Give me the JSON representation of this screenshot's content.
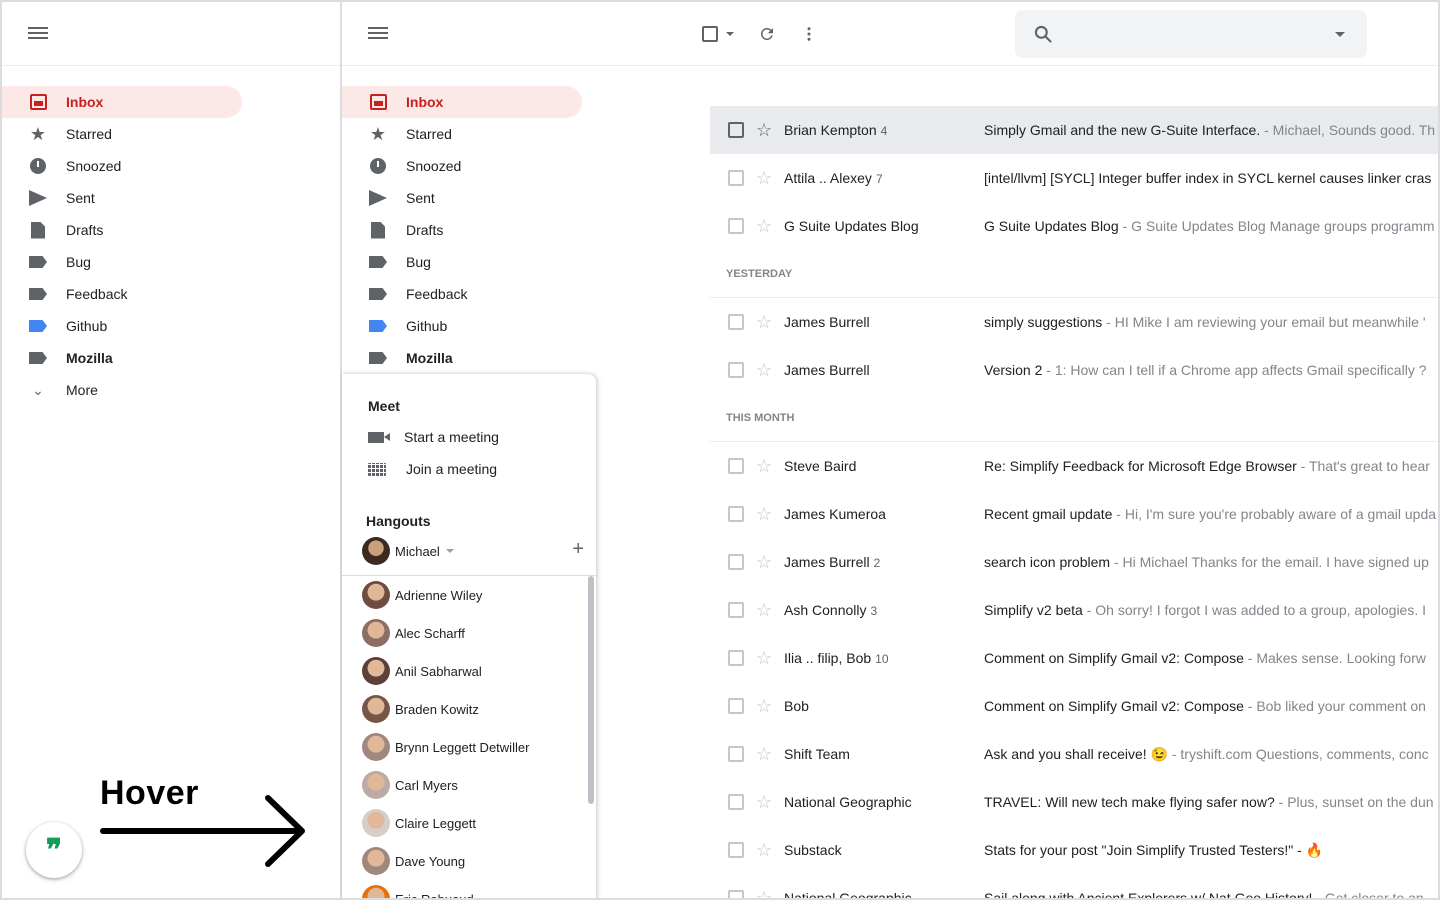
{
  "nav": [
    {
      "label": "Inbox",
      "icon": "inbox-icon",
      "active": true
    },
    {
      "label": "Starred",
      "icon": "star-icon"
    },
    {
      "label": "Snoozed",
      "icon": "clock-icon"
    },
    {
      "label": "Sent",
      "icon": "send-icon"
    },
    {
      "label": "Drafts",
      "icon": "draft-icon"
    },
    {
      "label": "Bug",
      "icon": "label-icon"
    },
    {
      "label": "Feedback",
      "icon": "label-icon"
    },
    {
      "label": "Github",
      "icon": "label-icon",
      "color": "#4285f4"
    },
    {
      "label": "Mozilla",
      "icon": "label-icon",
      "bold": true
    },
    {
      "label": "More",
      "icon": "chevron-down-icon"
    }
  ],
  "annotation": {
    "text": "Hover"
  },
  "hangouts_fab": {
    "glyph": "❞"
  },
  "popup": {
    "meet_title": "Meet",
    "start_meeting": "Start a meeting",
    "join_meeting": "Join a meeting",
    "hangouts_title": "Hangouts",
    "me_name": "Michael",
    "contacts": [
      "Adrienne Wiley",
      "Alec Scharff",
      "Anil Sabharwal",
      "Braden Kowitz",
      "Brynn Leggett Detwiller",
      "Carl Myers",
      "Claire Leggett",
      "Dave Young",
      "Eric Rabuaud"
    ]
  },
  "emails_top": [
    {
      "sender": "Brian Kempton",
      "count": "4",
      "subject": "Simply Gmail and the new G-Suite Interface.",
      "snippet": " - Michael, Sounds good. Th",
      "selected": true
    },
    {
      "sender": "Attila .. Alexey",
      "count": "7",
      "subject": "[intel/llvm] [SYCL] Integer buffer index in SYCL kernel causes linker cras",
      "snippet": ""
    },
    {
      "sender": "G Suite Updates Blog",
      "count": "",
      "subject": "G Suite Updates Blog",
      "snippet": " - G Suite Updates Blog Manage groups programm"
    }
  ],
  "section_yesterday": "YESTERDAY",
  "emails_yesterday": [
    {
      "sender": "James Burrell",
      "count": "",
      "subject": "simply suggestions",
      "snippet": " - HI Mike I am reviewing your email but meanwhile '"
    },
    {
      "sender": "James Burrell",
      "count": "",
      "subject": "Version 2",
      "snippet": " - 1: How can I tell if a Chrome app affects Gmail specifically ?"
    }
  ],
  "section_month": "THIS MONTH",
  "emails_month": [
    {
      "sender": "Steve Baird",
      "count": "",
      "subject": "Re: Simplify Feedback for Microsoft Edge Browser",
      "snippet": " - That's great to hear"
    },
    {
      "sender": "James Kumeroa",
      "count": "",
      "subject": "Recent gmail update",
      "snippet": " - Hi, I'm sure you're probably aware of a gmail upda"
    },
    {
      "sender": "James Burrell",
      "count": "2",
      "subject": "search icon problem",
      "snippet": " - Hi Michael Thanks for the email. I have signed up"
    },
    {
      "sender": "Ash Connolly",
      "count": "3",
      "subject": "Simplify v2 beta",
      "snippet": " - Oh sorry! I forgot I was added to a group, apologies. I"
    },
    {
      "sender": "Ilia .. filip, Bob",
      "count": "10",
      "subject": "Comment on Simplify Gmail v2: Compose",
      "snippet": " - Makes sense. Looking forw"
    },
    {
      "sender": "Bob",
      "count": "",
      "subject": "Comment on Simplify Gmail v2: Compose",
      "snippet": " - Bob liked your comment on"
    },
    {
      "sender": "Shift Team",
      "count": "",
      "subject": "Ask and you shall receive! 😉",
      "snippet": " - tryshift.com Questions, comments, conc"
    },
    {
      "sender": "National Geographic",
      "count": "",
      "subject": "TRAVEL: Will new tech make flying safer now?",
      "snippet": " - Plus, sunset on the dun"
    },
    {
      "sender": "Substack",
      "count": "",
      "subject": "Stats for your post \"Join Simplify Trusted Testers!\" - 🔥",
      "snippet": ""
    },
    {
      "sender": "National Geographic",
      "count": "",
      "subject": "Sail along with Ancient Explorers w/ Nat Geo History!",
      "snippet": " - Get closer to an"
    }
  ]
}
